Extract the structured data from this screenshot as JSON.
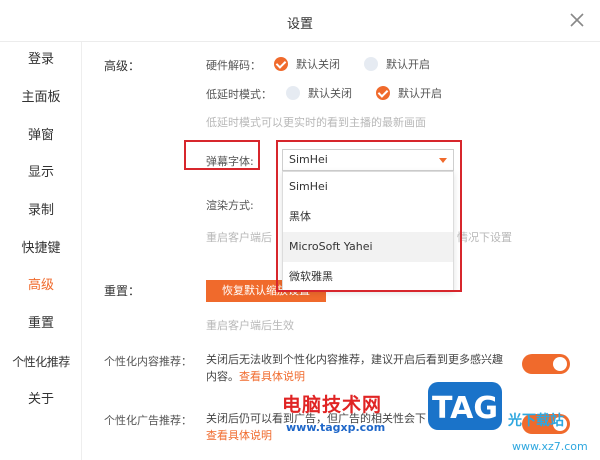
{
  "window": {
    "title": "设置"
  },
  "sidebar": {
    "items": [
      {
        "label": "登录"
      },
      {
        "label": "主面板"
      },
      {
        "label": "弹窗"
      },
      {
        "label": "显示"
      },
      {
        "label": "录制"
      },
      {
        "label": "快捷键"
      },
      {
        "label": "高级",
        "active": true
      },
      {
        "label": "重置"
      },
      {
        "label": "个性化推荐"
      },
      {
        "label": "关于"
      }
    ]
  },
  "advanced": {
    "section_label": "高级：",
    "hardware_decode": {
      "label": "硬件解码：",
      "options": [
        {
          "label": "默认关闭",
          "checked": true
        },
        {
          "label": "默认开启",
          "checked": false
        }
      ]
    },
    "low_latency": {
      "label": "低延时模式：",
      "options": [
        {
          "label": "默认关闭",
          "checked": false
        },
        {
          "label": "默认开启",
          "checked": true
        }
      ],
      "hint": "低延时模式可以更实时的看到主播的最新画面"
    },
    "danmaku_font": {
      "label": "弹幕字体:",
      "selected": "SimHei",
      "options": [
        "SimHei",
        "黑体",
        "MicroSoft Yahei",
        "微软雅黑"
      ]
    },
    "render_mode": {
      "label": "渲染方式:",
      "hint_left": "重启客户端后",
      "hint_right": "情况下设置"
    }
  },
  "reset": {
    "section_label": "重置：",
    "button_label": "恢复默认缩放设置",
    "hint": "重启客户端后生效"
  },
  "personalized": {
    "content": {
      "label": "个性化内容推荐：",
      "desc": "关闭后无法收到个性化内容推荐，建议开启后看到更多感兴趣内容。",
      "link": "查看具体说明",
      "enabled": true
    },
    "ads": {
      "label": "个性化广告推荐：",
      "desc": "关闭后仍可以看到广告，但广告的相关性会下",
      "link": "查看具体说明",
      "enabled": true
    }
  },
  "watermark": {
    "cn": "电脑技术网",
    "url": "www.tagxp.com",
    "tag": "TAG",
    "jx": "光下载站",
    "xz": "www.xz7.com"
  },
  "colors": {
    "accent": "#f06a2c",
    "highlight": "#d7262c",
    "hint": "#b8b8b8"
  }
}
